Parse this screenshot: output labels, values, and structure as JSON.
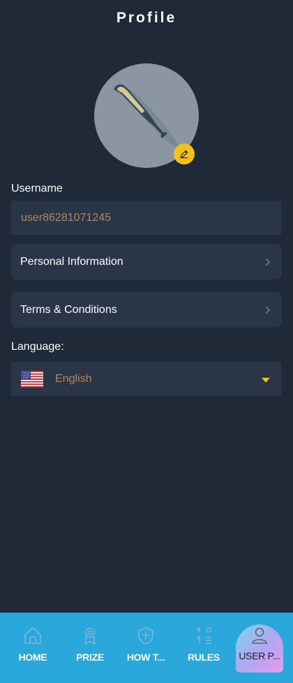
{
  "header": {
    "title": "Profile"
  },
  "avatar": {
    "edit_icon": "pencil-icon",
    "image": "baseball-bat"
  },
  "username": {
    "label": "Username",
    "value": "user86281071245"
  },
  "menu": [
    {
      "label": "Personal Information",
      "icon": "chevron-right-icon"
    },
    {
      "label": "Terms & Conditions",
      "icon": "chevron-right-icon"
    }
  ],
  "language": {
    "label": "Language:",
    "value": "English",
    "flag": "us-flag-icon",
    "caret": "caret-down-icon"
  },
  "bottom_nav": {
    "items": [
      {
        "label": "HOME",
        "icon": "home-icon"
      },
      {
        "label": "PRIZE",
        "icon": "prize-icon"
      },
      {
        "label": "HOW T...",
        "icon": "shield-icon"
      },
      {
        "label": "RULES",
        "icon": "rules-icon"
      },
      {
        "label": "USER P...",
        "icon": "user-icon",
        "active": true
      }
    ]
  },
  "colors": {
    "background": "#202937",
    "card": "#2a3548",
    "accent_gold": "#f2c21a",
    "muted_text": "#b6875b",
    "nav": "#2aa8dc"
  }
}
